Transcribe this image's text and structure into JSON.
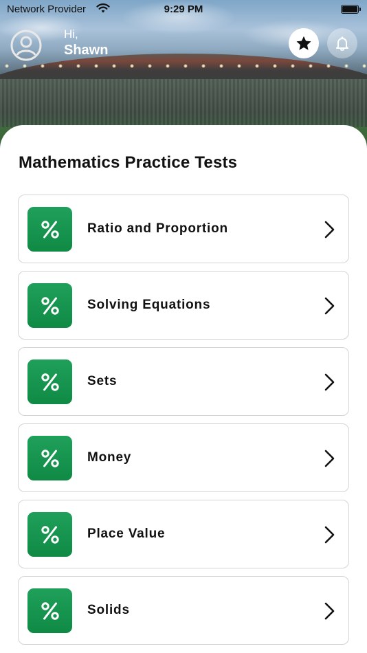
{
  "status_bar": {
    "carrier": "Network Provider",
    "time": "9:29 PM"
  },
  "header": {
    "greeting": "Hi,",
    "user_name": "Shawn",
    "icons": [
      "user-circle-icon",
      "star-icon",
      "bell-icon"
    ]
  },
  "main": {
    "title": "Mathematics Practice Tests",
    "tests": [
      {
        "label": "Ratio and Proportion",
        "icon": "percent-icon"
      },
      {
        "label": "Solving Equations",
        "icon": "percent-icon"
      },
      {
        "label": "Sets",
        "icon": "percent-icon"
      },
      {
        "label": "Money",
        "icon": "percent-icon"
      },
      {
        "label": "Place Value",
        "icon": "percent-icon"
      },
      {
        "label": "Solids",
        "icon": "percent-icon"
      }
    ]
  },
  "colors": {
    "icon_tile": "#129a4f",
    "text": "#111111",
    "card_border": "#d4d4d4"
  }
}
